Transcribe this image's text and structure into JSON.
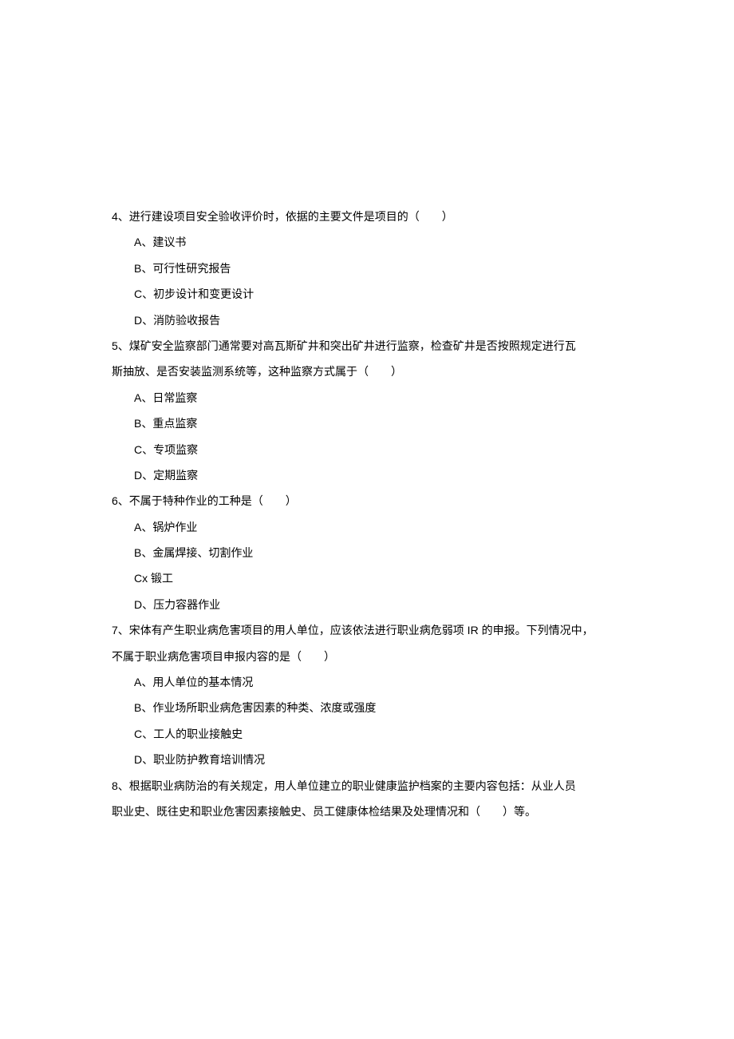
{
  "questions": [
    {
      "number": "4、",
      "text": "进行建设项目安全验收评价时，依据的主要文件是项目的（　　）",
      "options": [
        "A、建议书",
        "B、可行性研究报告",
        "C、初步设计和变更设计",
        "D、消防验收报告"
      ]
    },
    {
      "number": "5、",
      "text": "煤矿安全监察部门通常要对高瓦斯矿井和突出矿井进行监察，检查矿井是否按照规定进行瓦",
      "continuation": "斯抽放、是否安装监测系统等，这种监察方式属于（　　）",
      "options": [
        "A、日常监察",
        "B、重点监察",
        "C、专项监察",
        "D、定期监察"
      ]
    },
    {
      "number": "6、",
      "text": "不属于特种作业的工种是（　　）",
      "options": [
        "A、锅炉作业",
        "B、金属焊接、切割作业",
        "Cx 锻工",
        "D、压力容器作业"
      ]
    },
    {
      "number": "7、",
      "text": "宋体有产生职业病危害项目的用人单位，应该依法进行职业病危弱项 IR 的申报。下列情况中，",
      "continuation": "不属于职业病危害项目申报内容的是（　　）",
      "options": [
        "A、用人单位的基本情况",
        "B、作业场所职业病危害因素的种类、浓度或强度",
        "C、工人的职业接触史",
        "D、职业防护教育培训情况"
      ]
    },
    {
      "number": "8、",
      "text": "根据职业病防治的有关规定，用人单位建立的职业健康监护档案的主要内容包括：从业人员",
      "continuation": "职业史、既往史和职业危害因素接触史、员工健康体检结果及处理情况和（　　）等。",
      "options": []
    }
  ]
}
